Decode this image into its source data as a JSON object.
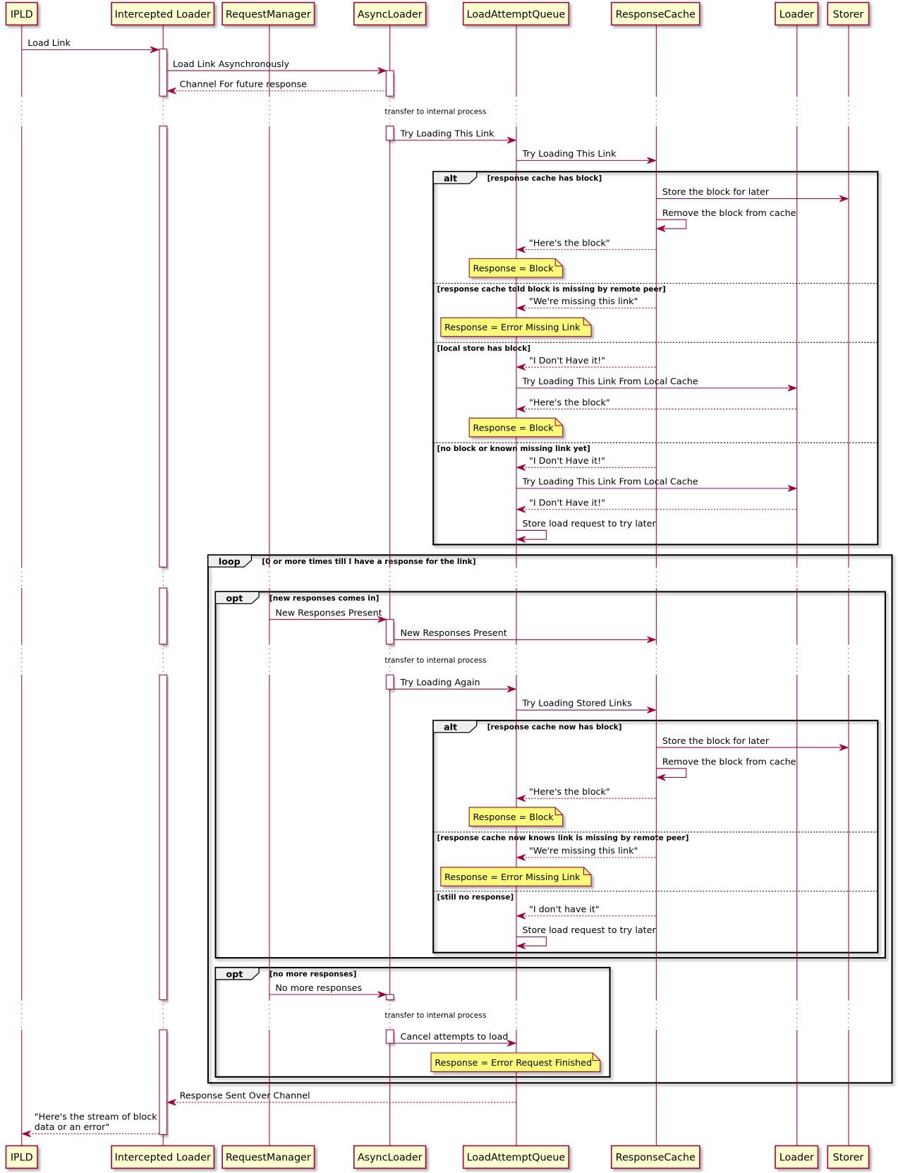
{
  "colors": {
    "line": "#A80036",
    "participant_fill": "#FEFECE",
    "note_fill": "#FBFB77",
    "frame_tab_fill": "#EEEEEE"
  },
  "participants": [
    "IPLD",
    "Intercepted Loader",
    "RequestManager",
    "AsyncLoader",
    "LoadAttemptQueue",
    "ResponseCache",
    "Loader",
    "Storer"
  ],
  "messages": [
    {
      "from": "IPLD",
      "to": "Intercepted Loader",
      "label": [
        "Load Link"
      ],
      "dashed": false
    },
    {
      "from": "Intercepted Loader",
      "to": "AsyncLoader",
      "label": [
        "Load Link Asynchronously"
      ],
      "dashed": false
    },
    {
      "from": "AsyncLoader",
      "to": "Intercepted Loader",
      "label": [
        "Channel For future response"
      ],
      "dashed": true
    },
    {
      "from": "AsyncLoader",
      "to": "LoadAttemptQueue",
      "label": [
        "Try Loading This Link"
      ],
      "dashed": false
    },
    {
      "from": "LoadAttemptQueue",
      "to": "ResponseCache",
      "label": [
        "Try Loading This Link"
      ],
      "dashed": false
    },
    {
      "from": "ResponseCache",
      "to": "Storer",
      "label": [
        "Store the block for later"
      ],
      "dashed": false
    },
    {
      "from": "ResponseCache",
      "to": "ResponseCache",
      "label": [
        "Remove the block from cache"
      ],
      "dashed": false
    },
    {
      "from": "ResponseCache",
      "to": "LoadAttemptQueue",
      "label": [
        "\"Here's the block\""
      ],
      "dashed": true
    },
    {
      "from": "ResponseCache",
      "to": "LoadAttemptQueue",
      "label": [
        "\"We're missing this link\""
      ],
      "dashed": true
    },
    {
      "from": "ResponseCache",
      "to": "LoadAttemptQueue",
      "label": [
        "\"I Don't Have it!\""
      ],
      "dashed": true
    },
    {
      "from": "LoadAttemptQueue",
      "to": "Loader",
      "label": [
        "Try Loading This Link From Local Cache"
      ],
      "dashed": false
    },
    {
      "from": "Loader",
      "to": "LoadAttemptQueue",
      "label": [
        "\"Here's the block\""
      ],
      "dashed": true
    },
    {
      "from": "ResponseCache",
      "to": "LoadAttemptQueue",
      "label": [
        "\"I Don't Have it!\""
      ],
      "dashed": true
    },
    {
      "from": "LoadAttemptQueue",
      "to": "Loader",
      "label": [
        "Try Loading This Link From Local Cache"
      ],
      "dashed": false
    },
    {
      "from": "Loader",
      "to": "LoadAttemptQueue",
      "label": [
        "\"I Don't Have it!\""
      ],
      "dashed": true
    },
    {
      "from": "LoadAttemptQueue",
      "to": "LoadAttemptQueue",
      "label": [
        "Store load request to try later"
      ],
      "dashed": false
    },
    {
      "from": "RequestManager",
      "to": "AsyncLoader",
      "label": [
        "New Responses Present"
      ],
      "dashed": false
    },
    {
      "from": "AsyncLoader",
      "to": "ResponseCache",
      "label": [
        "New Responses Present"
      ],
      "dashed": false
    },
    {
      "from": "AsyncLoader",
      "to": "LoadAttemptQueue",
      "label": [
        "Try Loading Again"
      ],
      "dashed": false
    },
    {
      "from": "LoadAttemptQueue",
      "to": "ResponseCache",
      "label": [
        "Try Loading Stored Links"
      ],
      "dashed": false
    },
    {
      "from": "ResponseCache",
      "to": "Storer",
      "label": [
        "Store the block for later"
      ],
      "dashed": false
    },
    {
      "from": "ResponseCache",
      "to": "ResponseCache",
      "label": [
        "Remove the block from cache"
      ],
      "dashed": false
    },
    {
      "from": "ResponseCache",
      "to": "LoadAttemptQueue",
      "label": [
        "\"Here's the block\""
      ],
      "dashed": true
    },
    {
      "from": "ResponseCache",
      "to": "LoadAttemptQueue",
      "label": [
        "\"We're missing this link\""
      ],
      "dashed": true
    },
    {
      "from": "ResponseCache",
      "to": "LoadAttemptQueue",
      "label": [
        "\"I don't have it\""
      ],
      "dashed": true
    },
    {
      "from": "LoadAttemptQueue",
      "to": "LoadAttemptQueue",
      "label": [
        "Store load request to try later"
      ],
      "dashed": false
    },
    {
      "from": "RequestManager",
      "to": "AsyncLoader",
      "label": [
        "No more responses"
      ],
      "dashed": false
    },
    {
      "from": "AsyncLoader",
      "to": "LoadAttemptQueue",
      "label": [
        "Cancel attempts to load"
      ],
      "dashed": false
    },
    {
      "from": "LoadAttemptQueue",
      "to": "Intercepted Loader",
      "label": [
        "Response Sent Over Channel"
      ],
      "dashed": true
    },
    {
      "from": "Intercepted Loader",
      "to": "IPLD",
      "label": [
        "\"Here's the stream of block",
        " data or an error\""
      ],
      "dashed": true
    }
  ],
  "notes": [
    {
      "over": "LoadAttemptQueue",
      "text": "Response = Block"
    },
    {
      "over": "LoadAttemptQueue",
      "text": "Response = Error Missing Link"
    },
    {
      "over": "LoadAttemptQueue",
      "text": "Response = Block"
    },
    {
      "over": "LoadAttemptQueue",
      "text": "Response = Block"
    },
    {
      "over": "LoadAttemptQueue",
      "text": "Response = Error Missing Link"
    },
    {
      "over": "LoadAttemptQueue",
      "text": "Response = Error Request Finished"
    }
  ],
  "frames": [
    {
      "kind": "alt",
      "guards": [
        "[response cache has block]",
        "[response cache told block is missing by remote peer]",
        "[local store has block]",
        "[no block or known missing link yet]"
      ]
    },
    {
      "kind": "loop",
      "guards": [
        "[0 or more times till I have a response for the link]"
      ]
    },
    {
      "kind": "opt",
      "guards": [
        "[new responses comes in]"
      ]
    },
    {
      "kind": "alt",
      "guards": [
        "[response cache now has block]",
        "[response cache now knows link is missing by remote peer]",
        "[still no response]"
      ]
    },
    {
      "kind": "opt",
      "guards": [
        "[no more responses]"
      ]
    }
  ],
  "delays": [
    {
      "label": "transfer to internal process"
    },
    {
      "label": ""
    },
    {
      "label": "transfer to internal process"
    },
    {
      "label": "transfer to internal process"
    }
  ]
}
